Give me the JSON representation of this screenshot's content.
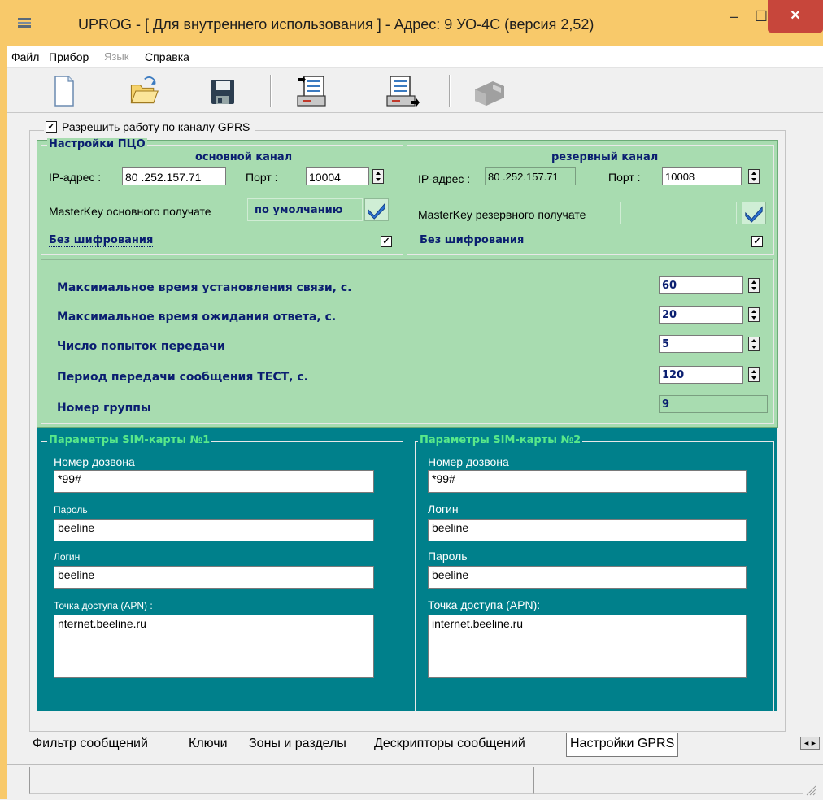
{
  "window": {
    "title": "UPROG - [ Для внутреннего использования ] - Адрес:  9  УО-4С (версия  2,52)",
    "minimize_glyph": "–",
    "maximize_glyph": "☐",
    "close_glyph": "✕"
  },
  "menu": {
    "file": "Файл",
    "device": "Прибор",
    "language": "Язык",
    "help": "Справка"
  },
  "toolbar": {
    "icons": [
      "new-file-icon",
      "open-folder-icon",
      "save-icon",
      "read-device-icon",
      "write-device-icon",
      "disabled-device-icon"
    ]
  },
  "gprs": {
    "enable_label": "Разрешить работу по каналу GPRS",
    "enable_checked": "✓",
    "pco_group_label": "Настройки ПЦО",
    "main": {
      "heading": "основной канал",
      "ip_label": "IP-адрес :",
      "ip_value": "80 .252.157.71",
      "port_label": "Порт :",
      "port_value": "10004",
      "masterkey_label": "MasterKey основного получате",
      "masterkey_value": "по умолчанию",
      "noenc_label": "Без шифрования",
      "noenc_checked": "✓"
    },
    "reserve": {
      "heading": "резервный канал",
      "ip_label": "IP-адрес :",
      "ip_value": "80 .252.157.71",
      "port_label": "Порт :",
      "port_value": "10008",
      "masterkey_label": "MasterKey резервного получате",
      "masterkey_value": "",
      "noenc_label": "Без шифрования",
      "noenc_checked": "✓"
    },
    "params": {
      "max_connect_label": "Максимальное время установления связи, с.",
      "max_connect_value": "60",
      "max_wait_label": "Максимальное время ожидания ответа, с.",
      "max_wait_value": "20",
      "attempts_label": "Число попыток передачи",
      "attempts_value": "5",
      "test_period_label": "Период передачи сообщения ТЕСТ, с.",
      "test_period_value": "120",
      "group_label": "Номер группы",
      "group_value": "9"
    }
  },
  "sim1": {
    "title": "Параметры SIM-карты №1",
    "dial_label": "Номер дозвона",
    "dial_value": "*99#",
    "password_label": "Пароль",
    "password_value": "beeline",
    "login_label": "Логин",
    "login_value": "beeline",
    "apn_label": "Точка доступа (APN) :",
    "apn_value": "nternet.beeline.ru"
  },
  "sim2": {
    "title": "Параметры SIM-карты №2",
    "dial_label": "Номер дозвона",
    "dial_value": "*99#",
    "login_label": "Логин",
    "login_value": "beeline",
    "password_label": "Пароль",
    "password_value": "beeline",
    "apn_label": "Точка доступа (APN):",
    "apn_value": "internet.beeline.ru"
  },
  "tabs": {
    "filter": "Фильтр сообщений",
    "keys": "Ключи",
    "zones": "Зоны и разделы",
    "descriptors": "Дескрипторы сообщений",
    "gprs": "Настройки GPRS",
    "active": "Настройки GPRS"
  },
  "colors": {
    "titlebar": "#f8c96a",
    "panel_green": "#a8dcb0",
    "panel_teal": "#00808b",
    "label_navy": "#0a1e70",
    "sim_title_green": "#58e88a",
    "close_red": "#c7463b"
  }
}
